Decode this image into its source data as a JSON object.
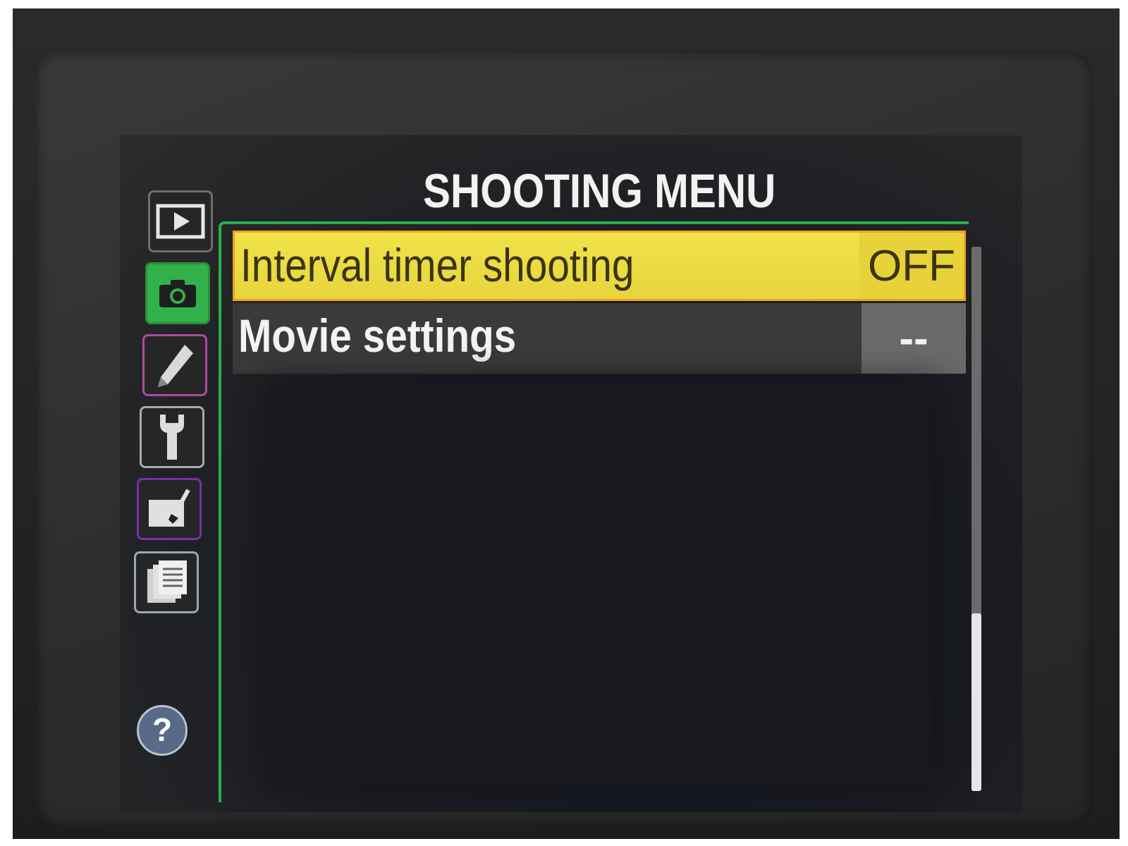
{
  "menu": {
    "title": "SHOOTING MENU",
    "items": [
      {
        "label": "Interval timer shooting",
        "value": "OFF",
        "selected": true
      },
      {
        "label": "Movie settings",
        "value": "--",
        "selected": false
      }
    ]
  },
  "tabs": [
    {
      "name": "playback",
      "icon": "play-icon"
    },
    {
      "name": "shooting",
      "icon": "camera-icon",
      "active": true
    },
    {
      "name": "custom",
      "icon": "pencil-icon"
    },
    {
      "name": "setup",
      "icon": "wrench-icon"
    },
    {
      "name": "retouch",
      "icon": "retouch-brush-icon"
    },
    {
      "name": "recent",
      "icon": "recent-settings-icon"
    }
  ],
  "help": {
    "symbol": "?"
  },
  "colors": {
    "selected_row": "#f2e24a",
    "selected_border": "#f0a020",
    "active_tab": "#32b14a",
    "frame_green": "#28b04a"
  }
}
